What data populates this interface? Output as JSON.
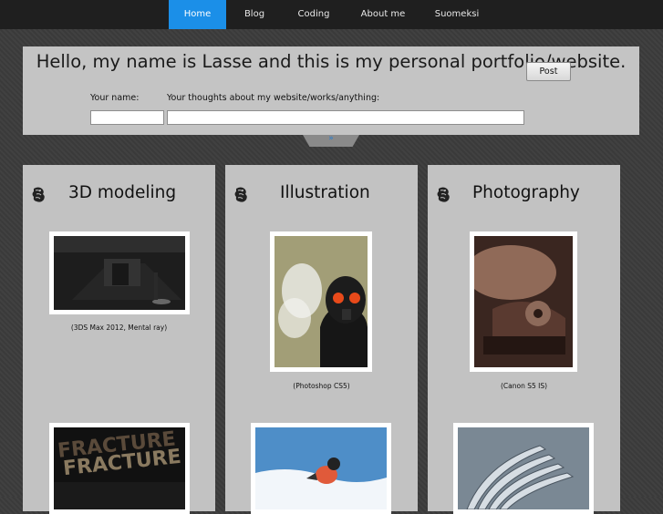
{
  "nav": {
    "items": [
      {
        "label": "Home",
        "active": true
      },
      {
        "label": "Blog",
        "active": false
      },
      {
        "label": "Coding",
        "active": false
      },
      {
        "label": "About me",
        "active": false
      },
      {
        "label": "Suomeksi",
        "active": false
      }
    ]
  },
  "header": {
    "headline": "Hello, my name is Lasse and this is my personal portfolio/website.",
    "name_label": "Your name:",
    "thoughts_label": "Your thoughts about my website/works/anything:",
    "name_value": "",
    "thoughts_value": "",
    "post_label": "Post",
    "toggle_glyph": "»"
  },
  "columns": [
    {
      "title": "3D modeling",
      "items": [
        {
          "caption": "(3DS Max 2012, Mental ray)",
          "image": "dark-3d-interior-render"
        },
        {
          "caption": "",
          "image": "fracture-3d-text"
        }
      ]
    },
    {
      "title": "Illustration",
      "items": [
        {
          "caption": "(Photoshop CS5)",
          "image": "gas-mask-soldier"
        },
        {
          "caption": "",
          "image": "bullfinch-bird-snow"
        }
      ]
    },
    {
      "title": "Photography",
      "items": [
        {
          "caption": "(Canon S5 IS)",
          "image": "hard-drive-closeup"
        },
        {
          "caption": "",
          "image": "metal-blades-closeup"
        }
      ]
    }
  ],
  "colors": {
    "accent": "#1b8fe8",
    "panel": "#c4c4c4",
    "nav": "#1f1f1f"
  }
}
